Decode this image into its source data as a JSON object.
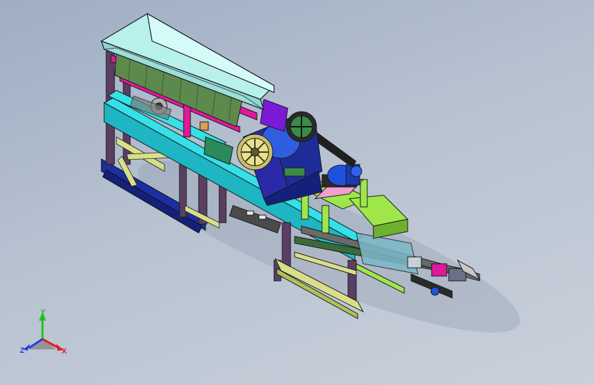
{
  "viewport": {
    "background_top": "#9faec4",
    "background_bottom": "#c9d0da"
  },
  "model": {
    "description_icon": "crusher-assembly-3d-model",
    "colors": {
      "hopper": "#b8f0ec",
      "hopper_edge": "#1a1a1a",
      "magenta_frame": "#e0189a",
      "feeder_bed": "#5d8a4c",
      "cyan_frame": "#35e0e8",
      "dark_frame": "#5a3e64",
      "base_blue": "#1b2fa0",
      "green_frame": "#9ee64a",
      "yellow_frame": "#d8de8a",
      "crusher_body": "#2a2aa8",
      "crusher_blue": "#2f5fe0",
      "flywheel": "#c8c06a",
      "purple": "#7a1ad8",
      "motor": "#2050e0",
      "pink": "#f0a0d0",
      "belt": "#202020"
    }
  },
  "triad": {
    "x_label": "X",
    "y_label": "Y",
    "z_label": "Z",
    "x_color": "#e02020",
    "y_color": "#20c020",
    "z_color": "#2040e0"
  }
}
